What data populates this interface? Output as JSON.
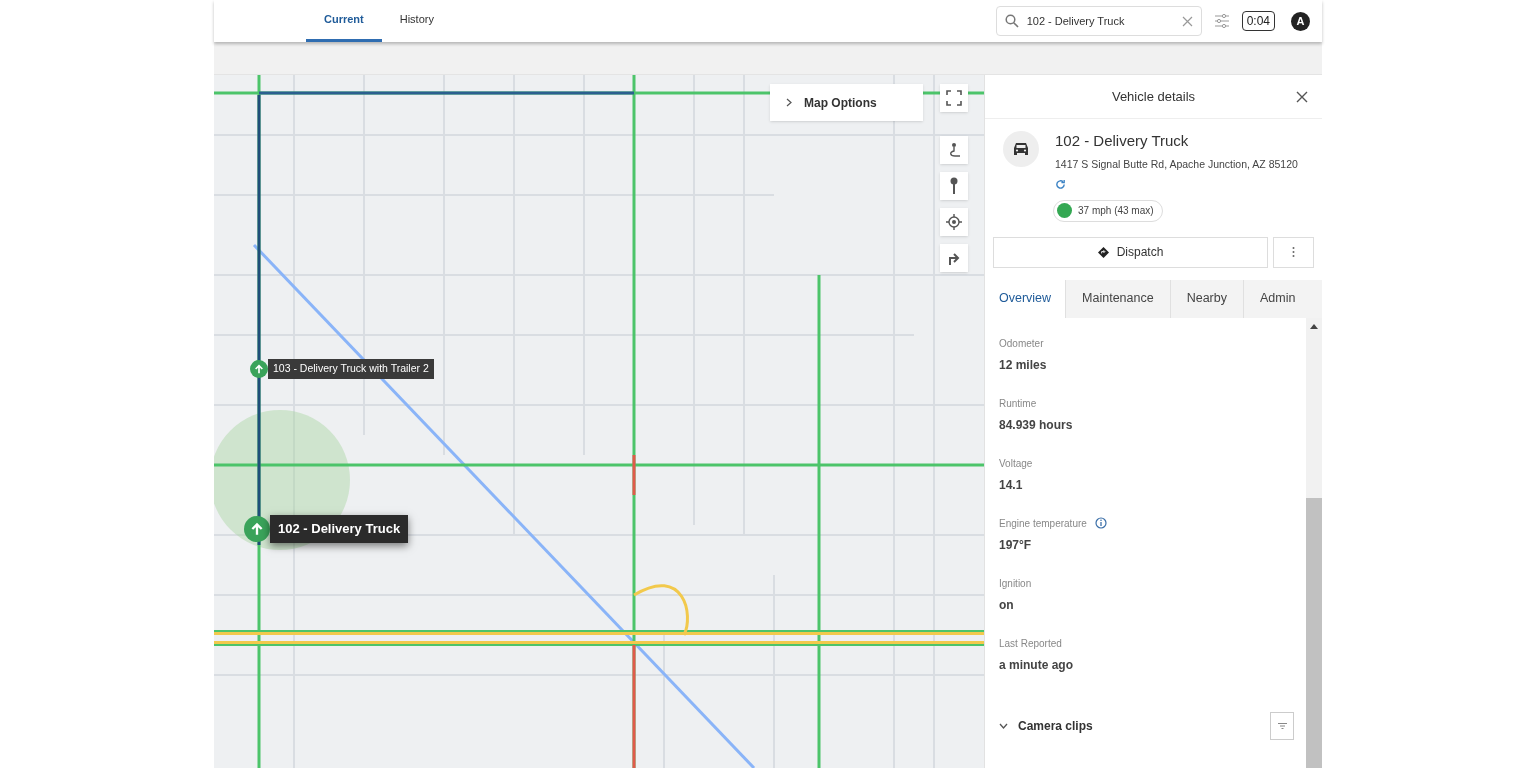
{
  "top_bar": {
    "tabs": [
      {
        "label": "Current",
        "selected": true
      },
      {
        "label": "History",
        "selected": false
      }
    ],
    "search": {
      "value": "102 - Delivery Truck"
    },
    "refresh_timer": "0:04",
    "avatar": "A"
  },
  "map": {
    "options_label": "Map Options",
    "vehicles": [
      {
        "label": "103 - Delivery Truck with Trailer 2",
        "selected": false
      },
      {
        "label": "102 - Delivery Truck",
        "selected": true
      }
    ]
  },
  "vehicle_panel": {
    "title": "Vehicle details",
    "name": "102 - Delivery Truck",
    "address": "1417 S Signal Butte Rd, Apache Junction, AZ 85120",
    "speed": {
      "text": "37 mph (43 max)",
      "color": "#34a853"
    },
    "dispatch": "Dispatch",
    "tabs": [
      {
        "label": "Overview",
        "selected": true
      },
      {
        "label": "Maintenance",
        "selected": false
      },
      {
        "label": "Nearby",
        "selected": false
      },
      {
        "label": "Admin",
        "selected": false
      }
    ],
    "fields": [
      {
        "label": "Odometer",
        "value": "12 miles",
        "info": false
      },
      {
        "label": "Runtime",
        "value": "84.939 hours",
        "info": false
      },
      {
        "label": "Voltage",
        "value": "14.1",
        "info": false
      },
      {
        "label": "Engine temperature",
        "value": "197°F",
        "info": true
      },
      {
        "label": "Ignition",
        "value": "on",
        "info": false
      },
      {
        "label": "Last Reported",
        "value": "a minute ago",
        "info": false
      }
    ],
    "section": {
      "label": "Camera clips",
      "expanded": true
    }
  }
}
